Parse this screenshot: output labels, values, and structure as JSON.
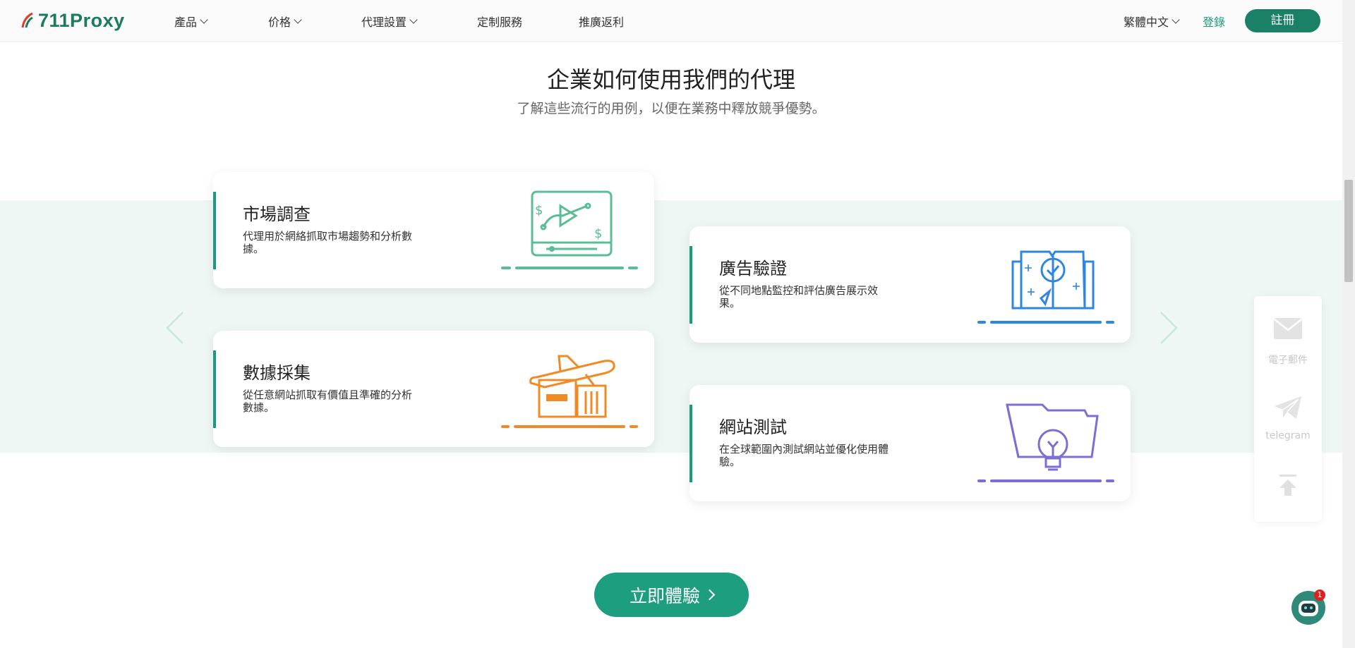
{
  "nav": {
    "brand": "711Proxy",
    "items": [
      {
        "label": "產品",
        "dropdown": true
      },
      {
        "label": "价格",
        "dropdown": true
      },
      {
        "label": "代理設置",
        "dropdown": true
      },
      {
        "label": "定制服務",
        "dropdown": false
      },
      {
        "label": "推廣返利",
        "dropdown": false
      }
    ],
    "language": "繁體中文",
    "login": "登錄",
    "register": "註冊"
  },
  "section": {
    "title": "企業如何使用我們的代理",
    "subtitle": "了解這些流行的用例，以便在業務中釋放競爭優勢。"
  },
  "cards": [
    {
      "title": "市場調查",
      "desc": "代理用於網絡抓取市場趨勢和分析數據。",
      "color": "#5bbd96",
      "icon": "market-research-icon"
    },
    {
      "title": "廣告驗證",
      "desc": "從不同地點監控和評估廣告展示效果。",
      "color": "#2f86e0",
      "icon": "ad-verification-icon"
    },
    {
      "title": "數據採集",
      "desc": "從任意網站抓取有價值且準確的分析數據。",
      "color": "#f08a24",
      "icon": "data-collection-icon"
    },
    {
      "title": "網站測試",
      "desc": "在全球範圍內測試網站並優化使用體驗。",
      "color": "#7b6fd6",
      "icon": "website-testing-icon"
    }
  ],
  "cta": {
    "label": "立即體驗"
  },
  "float": {
    "email": "電子郵件",
    "telegram": "telegram"
  },
  "chat": {
    "badge": "1"
  }
}
